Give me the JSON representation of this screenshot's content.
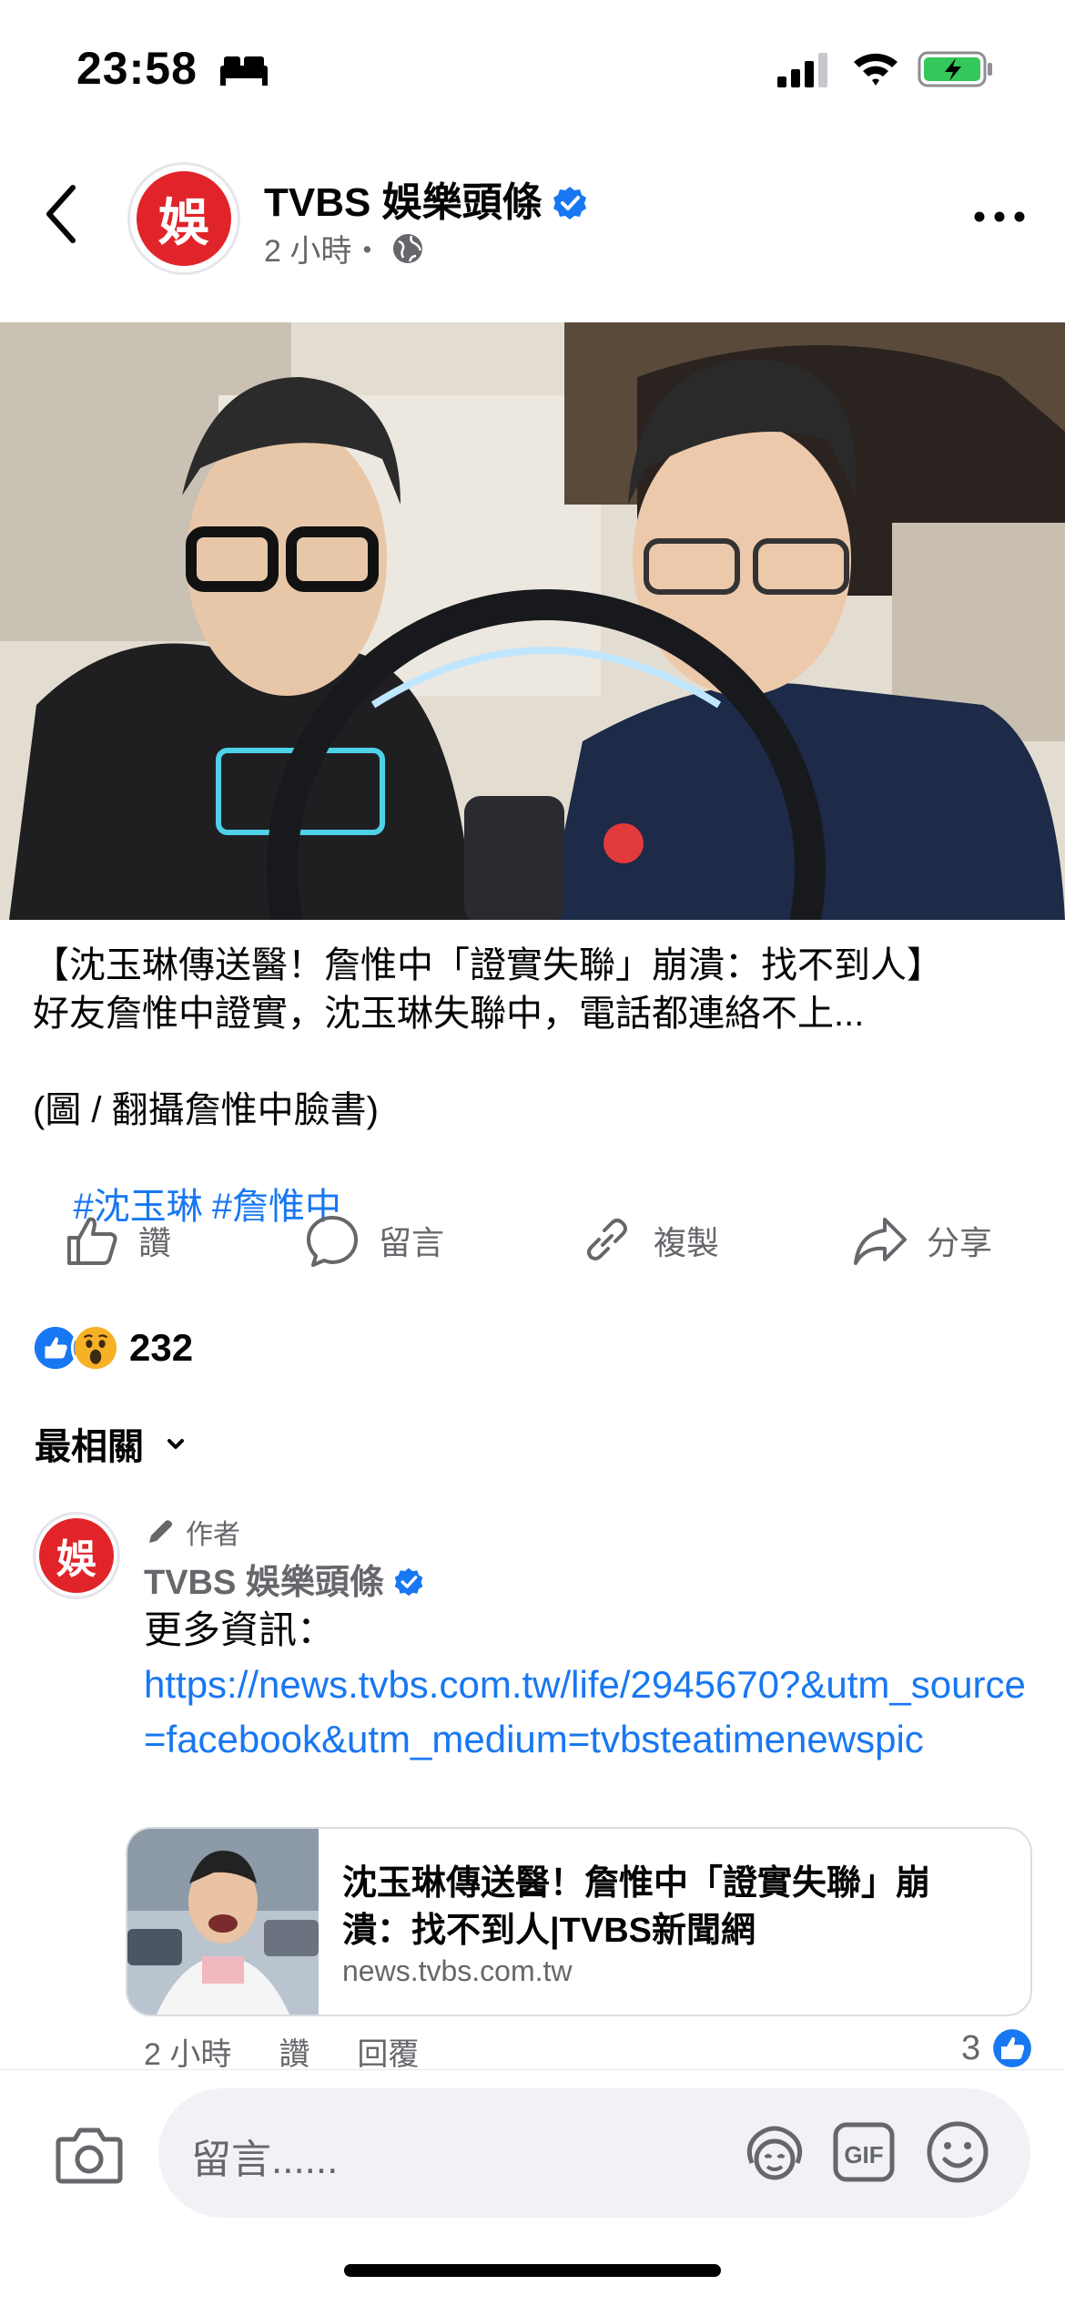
{
  "status_bar": {
    "time": "23:58",
    "focus_icon": "bed-icon",
    "signal_icon": "cellular-signal-icon",
    "wifi_icon": "wifi-icon",
    "battery_icon": "battery-charging-icon",
    "battery_color": "#34c759"
  },
  "header": {
    "back_icon": "chevron-left-icon",
    "page_name": "TVBS 娛樂頭條",
    "avatar_text": "娛",
    "verified_icon": "verified-badge-icon",
    "post_time": "2 小時・",
    "audience_icon": "globe-icon",
    "more_icon": "more-horizontal-icon"
  },
  "post": {
    "image_alt": "post-photo",
    "caption_line1": "【沈玉琳傳送醫！詹惟中「證實失聯」崩潰：找不到人】",
    "caption_line2": "好友詹惟中證實，沈玉琳失聯中，電話都連絡不上...",
    "caption_line3": "(圖 / 翻攝詹惟中臉書)",
    "hashtags": [
      "#沈玉琳",
      "#詹惟中"
    ]
  },
  "actions": {
    "like_label": "讚",
    "comment_label": "留言",
    "copy_label": "複製",
    "share_label": "分享"
  },
  "reactions": {
    "count": "232",
    "types": [
      "like",
      "wow"
    ],
    "like_color": "#1877f2",
    "wow_color": "#f7b125"
  },
  "sort": {
    "label": "最相關"
  },
  "comment": {
    "author_tag": "作者",
    "name": "TVBS 娛樂頭條",
    "avatar_text": "娛",
    "text": "更多資訊：",
    "link": "https://news.tvbs.com.tw/life/2945670?&utm_source=facebook&utm_medium=tvbsteatimenewspic",
    "card_title": "沈玉琳傳送醫！詹惟中「證實失聯」崩潰：找不到人|TVBS新聞網",
    "card_domain": "news.tvbs.com.tw",
    "time": "2 小時",
    "like_action": "讚",
    "reply_action": "回覆",
    "like_count": "3"
  },
  "composer": {
    "placeholder": "留言......",
    "gif_label": "GIF"
  },
  "colors": {
    "accent": "#1877f2",
    "secondary_text": "#65676b",
    "brand_red": "#e1242a"
  }
}
